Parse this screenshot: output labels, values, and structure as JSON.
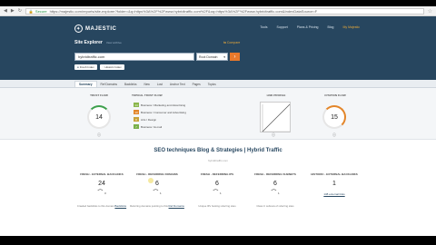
{
  "browser": {
    "url": "https://majestic.com/reports/site-explorer?folder=&q=https%3A%2F%2Fwww.hybridtraffic.com%2F&oq=https%3A%2F%2Fwww.hybridtraffic.com&IndexDataSource=F",
    "secure_label": "Secure"
  },
  "header": {
    "brand": "MAJESTIC",
    "nav": [
      "Tools",
      "Support",
      "Plans & Pricing",
      "Blog",
      "My Majestic"
    ],
    "title": "Site Explorer",
    "title_hint": "View archive",
    "compare_label": "Compare",
    "search_value": "hybridtraffic.com",
    "scope_value": "Root Domain",
    "toggles": [
      "Fresh Index",
      "Historic Index"
    ]
  },
  "tabs": [
    "Summary",
    "Ref Domains",
    "Backlinks",
    "New",
    "Lost",
    "Anchor Text",
    "Pages",
    "Topics"
  ],
  "active_tab": "Summary",
  "summary": {
    "trust_flow_label": "TRUST FLOW",
    "trust_flow": "14",
    "topical_label": "TOPICAL TRUST FLOW",
    "topical_items": [
      {
        "num": "14",
        "label": "Business / Marketing and Advertising",
        "color": "#8ab64a"
      },
      {
        "num": "10",
        "label": "Business / Consumer and Advertising",
        "color": "#e3862a"
      },
      {
        "num": "8",
        "label": "Arts / Design",
        "color": "#c8a23a"
      },
      {
        "num": "7",
        "label": "Business / E-mail",
        "color": "#7ab04a"
      }
    ],
    "link_profile_label": "LINK PROFILE",
    "citation_flow_label": "CITATION FLOW",
    "citation_flow": "15"
  },
  "content": {
    "title": "SEO techniques Blog & Strategies | Hybrid Traffic",
    "subtitle": "hybridtraffic.com",
    "stats": [
      {
        "label": "FRESH - EXTERNAL BACKLINKS",
        "value": "24",
        "delta": "3",
        "note": "Crawled backlinks to this domain",
        "link": "Backlinks"
      },
      {
        "label": "FRESH - REFERRING DOMAINS",
        "value": "6",
        "delta": "1",
        "note": "Referring domains pointing to this",
        "link": "Ref Domains"
      },
      {
        "label": "FRESH - REFERRING IPS",
        "value": "6",
        "delta": "1",
        "note": "Unique IPs hosting referring sites",
        "link": ""
      },
      {
        "label": "FRESH - REFERRING SUBNETS",
        "value": "6",
        "delta": "1",
        "note": "Class C subnets of referring sites",
        "link": ""
      },
      {
        "label": "HISTORIC - EXTERNAL BACKLINKS",
        "value": "1",
        "delta": "",
        "note": "",
        "link": "138 external links"
      }
    ]
  }
}
